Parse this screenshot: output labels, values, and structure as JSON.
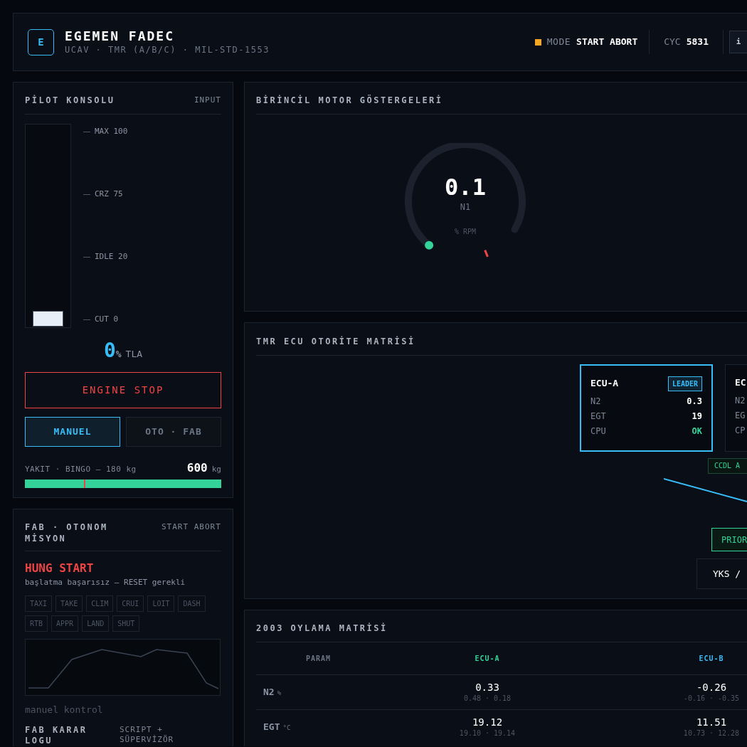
{
  "header": {
    "logo": "E",
    "title": "EGEMEN FADEC",
    "subtitle": "UCAV · TMR (A/B/C) · MIL-STD-1553",
    "mode_label": "MODE",
    "mode_value": "START ABORT",
    "cycle_label": "CYC",
    "cycle_value": "5831",
    "info_button": "i"
  },
  "pilot_console": {
    "title": "PİLOT KONSOLU",
    "tag": "INPUT",
    "throttle": {
      "level": 0,
      "ticks": [
        "MAX 100",
        "CRZ 75",
        "IDLE 20",
        "CUT 0"
      ]
    },
    "reading": "0",
    "reading_unit": "%",
    "reading_label": "TLA",
    "engine_stop": "ENGINE STOP",
    "modes": [
      {
        "label": "MANUEL",
        "selected": true
      },
      {
        "label": "OTO · FAB",
        "selected": false
      }
    ],
    "fuel": {
      "label": "YAKIT · BINGO — 180 kg",
      "value": "600",
      "unit": "kg",
      "level": 1,
      "bingo_marker": {
        "level": 0.3
      }
    }
  },
  "mission": {
    "title": "FAB · OTONOM MİSYON",
    "status": "START ABORT",
    "alert": "HUNG START",
    "message": "başlatma başarısız — RESET gerekli",
    "phases": [
      "TAXI",
      "TAKE",
      "CLIM",
      "CRUI",
      "LOIT",
      "DASH",
      "RTB",
      "APPR",
      "LAND",
      "SHUT"
    ],
    "note": "manuel kontrol"
  },
  "decision_log": {
    "title": "FAB KARAR LOGU",
    "tag": "SCRIPT + SÜPERVİZÖR"
  },
  "engine_gauges": {
    "title": "BİRİNCİL MOTOR GÖSTERGELERİ",
    "gauge": {
      "value": "0.1",
      "label": "N1",
      "unit": "% RPM"
    }
  },
  "tmr": {
    "title": "TMR ECU OTORİTE MATRİSİ",
    "ecus": [
      {
        "name": "ECU-A",
        "badge": "LEADER",
        "selected": true,
        "rows": [
          {
            "label": "N2",
            "value": "0.3",
            "kind": "number"
          },
          {
            "label": "EGT",
            "value": "19",
            "kind": "number"
          },
          {
            "label": "CPU",
            "value": "OK",
            "kind": "status"
          }
        ]
      },
      {
        "name": "EC",
        "selected": false,
        "rows": [
          {
            "label": "N2"
          },
          {
            "label": "EG"
          },
          {
            "label": "CP"
          }
        ]
      }
    ],
    "link_label": "CCDL A",
    "priority_button": "PRIOR",
    "yks_button": "YKS /"
  },
  "voting": {
    "title": "2003 OYLAMA MATRİSİ",
    "columns": [
      {
        "label": "PARAM"
      },
      {
        "label": "ECU-A",
        "color": "#34d399"
      },
      {
        "label": "ECU-B",
        "color": "#38bdf8"
      }
    ],
    "rows": [
      {
        "cells": [
          {
            "kind": "param",
            "value": "N2",
            "unit": "%"
          },
          {
            "kind": "vote",
            "value": "0.33",
            "range": "0.48 · 0.18"
          },
          {
            "kind": "vote",
            "value": "-0.26",
            "range": "-0.16 · -0.35"
          }
        ]
      },
      {
        "cells": [
          {
            "kind": "param",
            "value": "EGT",
            "unit": "°C"
          },
          {
            "kind": "vote",
            "value": "19.12",
            "range": "19.10 · 19.14"
          },
          {
            "kind": "vote",
            "value": "11.51",
            "range": "10.73 · 12.28"
          }
        ]
      }
    ]
  }
}
